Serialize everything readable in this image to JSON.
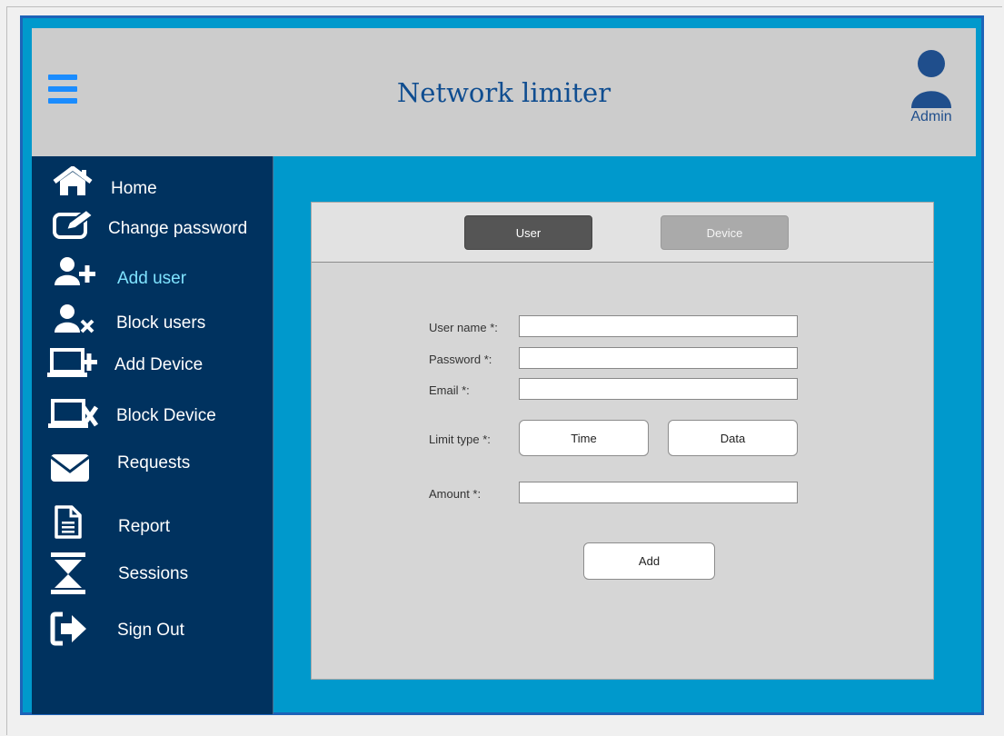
{
  "app": {
    "title": "Network limiter"
  },
  "user_menu": {
    "label": "Admin",
    "icon": "user-avatar-icon"
  },
  "sidebar": {
    "items": [
      {
        "label": "Home",
        "icon": "home-icon"
      },
      {
        "label": "Change password",
        "icon": "edit-icon"
      },
      {
        "label": "Add user",
        "icon": "add-user-icon",
        "active": true
      },
      {
        "label": "Block users",
        "icon": "block-user-icon"
      },
      {
        "label": "Add Device",
        "icon": "add-device-icon"
      },
      {
        "label": "Block Device",
        "icon": "block-device-icon"
      },
      {
        "label": "Requests",
        "icon": "envelope-icon"
      },
      {
        "label": "Report",
        "icon": "document-icon"
      },
      {
        "label": "Sessions",
        "icon": "hourglass-icon"
      },
      {
        "label": "Sign Out",
        "icon": "sign-out-icon"
      }
    ]
  },
  "tabs": {
    "user": "User",
    "device": "Device",
    "selected": "User"
  },
  "form": {
    "username_label": "User name *:",
    "password_label": "Password *:",
    "email_label": "Email *:",
    "limit_type_label": "Limit type *:",
    "limit_time": "Time",
    "limit_data": "Data",
    "amount_label": "Amount *:",
    "submit_label": "Add"
  },
  "colors": {
    "header_bg": "#cccccc",
    "sidebar_bg": "#00325f",
    "content_bg": "#0099cc",
    "active_nav": "#7fe3ff",
    "title": "#0f4d90",
    "accent": "#1a8cff"
  }
}
